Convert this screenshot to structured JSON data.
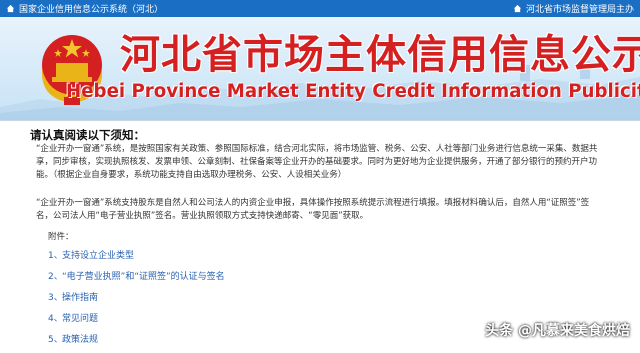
{
  "topbar": {
    "site_name": "国家企业信用信息公示系统（河北）",
    "organizer": "河北省市场监督管理局主办",
    "bg_color": "#1a6fc4"
  },
  "banner": {
    "title_cn": "河北省市场主体信用信息公示系统",
    "title_en": "Hebei Province Market Entity Credit Information Publicity System",
    "title_color": "#d42020"
  },
  "notice": {
    "title": "请认真阅读以下须知：",
    "paragraph1": "“企业开办一窗通”系统，是按照国家有关政策、参照国际标准，结合河北实际，将市场监管、税务、公安、人社等部门业务进行信息统一采集、数据共享，同步审核，实现执照核发、发票申领、公章刻制、社保备案等企业开办的基础要求。同时为更好地为企业提供服务，开通了部分银行的预约开户功能。（根据企业自身要求，系统功能支持自由选取办理税务、公安、人设相关业务）",
    "paragraph2": "“企业开办一窗通”系统支持股东是自然人和公司法人的内资企业申报，具体操作按照系统提示流程进行填报。填报材料确认后，自然人用“证照签”签名，公司法人用“电子营业执照”签名。营业执照领取方式支持快递邮寄、“零见面”获取。",
    "attachments_label": "附件：",
    "attachments": [
      {
        "num": "1、",
        "label": "支持设立企业类型"
      },
      {
        "num": "2、",
        "label": "“电子营业执照”和“证照签”的认证与签名"
      },
      {
        "num": "3、",
        "label": "操作指南"
      },
      {
        "num": "4、",
        "label": "常见问题"
      },
      {
        "num": "5、",
        "label": "政策法规"
      }
    ]
  },
  "watermark": "头条 @凡慕来美食烘焙"
}
